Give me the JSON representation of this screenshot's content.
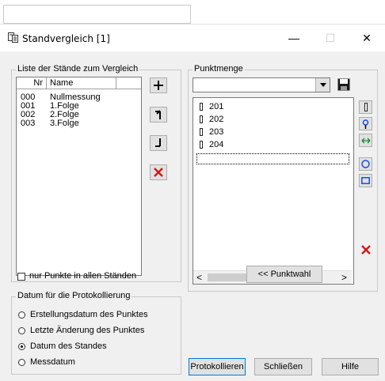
{
  "window": {
    "title": "Standvergleich [1]",
    "minimize": "—",
    "maximize": "☐",
    "close": "✕"
  },
  "staende": {
    "group_label": "Liste der Stände zum Vergleich",
    "col_nr": "Nr",
    "col_name": "Name",
    "rows": [
      {
        "nr": "000",
        "name": "Nullmessung"
      },
      {
        "nr": "001",
        "name": "1.Folge"
      },
      {
        "nr": "002",
        "name": "2.Folge"
      },
      {
        "nr": "003",
        "name": "3.Folge"
      }
    ],
    "buttons": {
      "add": "+",
      "up": "↑",
      "down": "↓",
      "delete": "✕"
    }
  },
  "punktmenge": {
    "group_label": "Punktmenge",
    "combo_value": "",
    "points": [
      "201",
      "202",
      "203",
      "204"
    ],
    "punktwahl_label": "<< Punktwahl"
  },
  "only_all_points_label": "nur Punkte in allen Ständen",
  "datum": {
    "group_label": "Datum für die Protokollierung",
    "options": [
      {
        "label": "Erstellungsdatum des Punktes",
        "selected": false
      },
      {
        "label": "Letzte Änderung des Punktes",
        "selected": false
      },
      {
        "label": "Datum des Standes",
        "selected": true
      },
      {
        "label": "Messdatum",
        "selected": false
      }
    ]
  },
  "footer": {
    "protokollieren": "Protokollieren",
    "schliessen": "Schließen",
    "hilfe": "Hilfe"
  }
}
